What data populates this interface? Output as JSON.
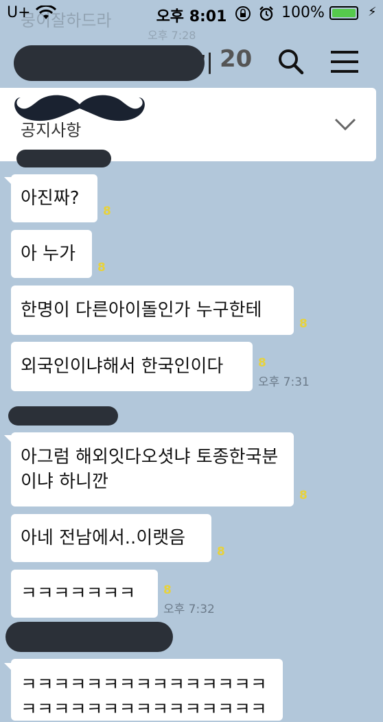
{
  "status_bar": {
    "carrier": "U+",
    "time": "오후 8:01",
    "battery_percent": "100%",
    "battery_level": 1.0,
    "battery_color": "#56c94c",
    "icons": [
      "wifi-icon",
      "orientation-lock-icon",
      "alarm-icon",
      "battery-icon",
      "charging-bolt-icon"
    ]
  },
  "background_ghost": {
    "message": "뭉이잘하드라",
    "time": "오후 7:28"
  },
  "header": {
    "title_tail": "기",
    "member_count": "20",
    "icons": [
      "search-icon",
      "menu-icon"
    ]
  },
  "notice": {
    "text": "공지사항",
    "icons": [
      "chevron-down-icon"
    ]
  },
  "messages": [
    {
      "text": "아진짜?",
      "unread": "8"
    },
    {
      "text": "아 누가",
      "unread": "8"
    },
    {
      "text": "한명이 다른아이돌인가 누구한테",
      "unread": "8"
    },
    {
      "text": "외국인이냐해서 한국인이다",
      "unread": "8",
      "time": "오후 7:31"
    },
    {
      "text": "아그럼 해외잇다오셧냐 토종한국분이냐 하니깐",
      "unread": "8"
    },
    {
      "text": "아네 전남에서..이랫음",
      "unread": "8"
    },
    {
      "text": "ㅋㅋㅋㅋㅋㅋㅋ",
      "unread": "8",
      "time": "오후 7:32"
    },
    {
      "text": "ㅋㅋㅋㅋㅋㅋㅋㅋㅋㅋㅋㅋㅋㅋㅋㅋㅋㅋㅋㅋㅋㅋㅋㅋㅋㅋㅋㅋㅋㅋ"
    }
  ],
  "colors": {
    "chat_background": "#b2c7da",
    "bubble": "#ffffff",
    "unread_count": "#e8d23a",
    "redaction": "#2b3038"
  }
}
